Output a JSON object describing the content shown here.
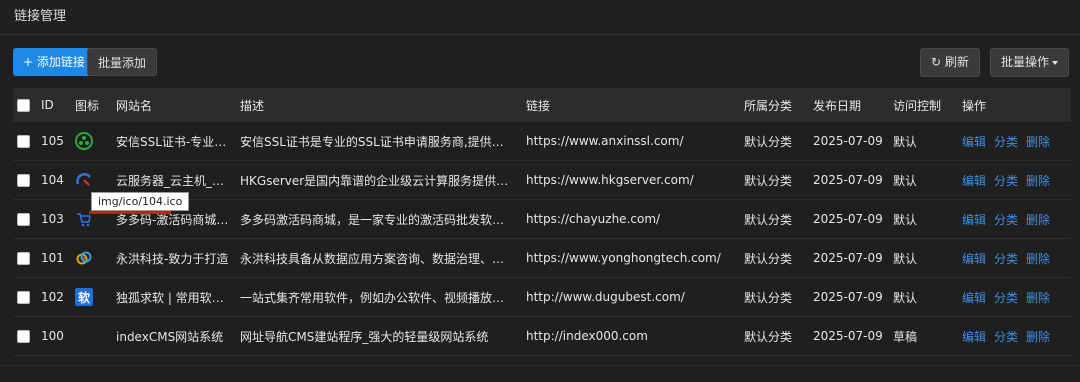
{
  "window": {
    "title": "链接管理"
  },
  "toolbar": {
    "add_label": "+ 添加链接",
    "batch_add_label": "批量添加",
    "refresh_label": "↻ 刷新",
    "batch_op_label": "批量操作"
  },
  "table": {
    "headers": {
      "id": "ID",
      "icon": "图标",
      "name": "网站名",
      "desc": "描述",
      "link": "链接",
      "category": "所属分类",
      "date": "发布日期",
      "access": "访问控制",
      "ops": "操作"
    },
    "rows": [
      {
        "id": "105",
        "icon": "anxin-icon",
        "name": "安信SSL证书-专业SSL证书",
        "desc": "安信SSL证书是专业的SSL证书申请服务商,提供DigiCert…",
        "link": "https://www.anxinssl.com/",
        "category": "默认分类",
        "date": "2025-07-09",
        "access": "默认",
        "ops": [
          "编辑",
          "分类",
          "删除"
        ]
      },
      {
        "id": "104",
        "icon": "hkgserver-icon",
        "name": "云服务器_云主机_弹性",
        "desc": "HKGserver是国内靠谱的企业级云计算服务提供商。…",
        "link": "https://www.hkgserver.com/",
        "category": "默认分类",
        "date": "2025-07-09",
        "access": "默认",
        "ops": [
          "编辑",
          "分类",
          "删除"
        ]
      },
      {
        "id": "103",
        "icon": "cart-icon",
        "name": "多多码-激活码商城-专业",
        "desc": "多多码激活码商城，是一家专业的激活码批发软件商…",
        "link": "https://chayuzhe.com/",
        "category": "默认分类",
        "date": "2025-07-09",
        "access": "默认",
        "ops": [
          "编辑",
          "分类",
          "删除"
        ]
      },
      {
        "id": "101",
        "icon": "yonghong-icon",
        "name": "永洪科技-致力于打造",
        "desc": "永洪科技具备从数据应用方案咨询、数据治理、数据…",
        "link": "https://www.yonghongtech.com/",
        "category": "默认分类",
        "date": "2025-07-09",
        "access": "默认",
        "ops": [
          "编辑",
          "分类",
          "删除"
        ]
      },
      {
        "id": "102",
        "icon": "soft-icon",
        "icon_text": "软",
        "name": "独孤求软 | 常用软件…",
        "desc": "一站式集齐常用软件，例如办公软件、视频播放、安…",
        "link": "http://www.dugubest.com/",
        "category": "默认分类",
        "date": "2025-07-09",
        "access": "默认",
        "ops": [
          "编辑",
          "分类",
          "删除"
        ]
      },
      {
        "id": "100",
        "icon": "",
        "name": "indexCMS网站系统",
        "desc": "网址导航CMS建站程序_强大的轻量级网站系统",
        "link": "http://index000.com",
        "category": "默认分类",
        "date": "2025-07-09",
        "access": "草稿",
        "ops": [
          "编辑",
          "分类",
          "删除"
        ]
      }
    ]
  },
  "tooltip": {
    "text": "img/ico/104.ico"
  },
  "colors": {
    "accent": "#1e88e5",
    "link": "#3d8fe6",
    "marker": "#d01b1b"
  }
}
